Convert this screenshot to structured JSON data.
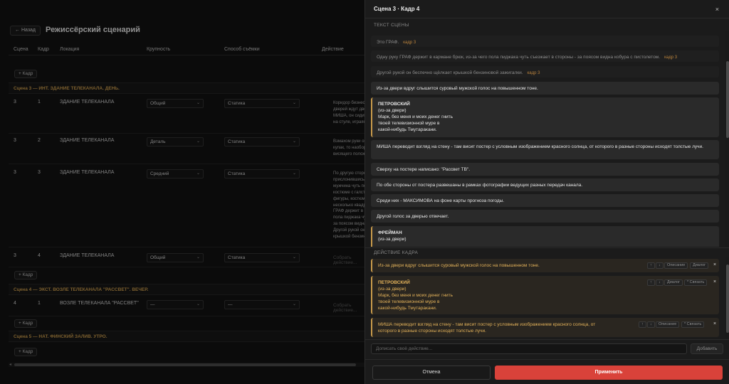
{
  "page": {
    "back_label": "← Назад",
    "title": "Режиссёрский сценарий",
    "columns": [
      "Сцена",
      "Кадр",
      "Локация",
      "Крупность",
      "Способ съёмки",
      "Действие"
    ],
    "add_frame_label": "+ Кадр",
    "action_placeholder": "Собрать действие...",
    "scenes": [
      {
        "header": "Сцена 3 — ИНТ. ЗДАНИЕ ТЕЛЕКАНАЛА. ДЕНЬ."
      },
      {
        "header": "Сцена 4 — ЭКСТ. ВОЗЛЕ ТЕЛЕКАНАЛА \"РАССВЕТ\". ВЕЧЕР."
      },
      {
        "header": "Сцена 5 — НАТ. ФИНСКИЙ ЗАЛИВ. УТРО."
      }
    ],
    "frames": [
      {
        "scene": "3",
        "frame": "1",
        "location": "ЗДАНИЕ ТЕЛЕКАНАЛА",
        "size": "Общий",
        "method": "Статика",
        "action": "Коридор бизнес-ц\nдверей ждут двое\nМИША, он сидит,\nна стуле, играясь\n"
      },
      {
        "scene": "3",
        "frame": "2",
        "location": "ЗДАНИЕ ТЕЛЕКАНАЛА",
        "size": "Деталь",
        "method": "Статика",
        "action": "Взмахом руки он\nкулак, то наоборо\nвисящего положе"
      },
      {
        "scene": "3",
        "frame": "3",
        "location": "ЗДАНИЕ ТЕЛЕКАНАЛА",
        "size": "Средний",
        "method": "Статика",
        "action": "По другую сторон\nприслонившись к\nмужчина чуть пос\nкостюме с галсту\nфигуры, костюм с\nнесколько квадра\nГРАФ держит в ка\nпола пиджака чут\nза поясом видна к\nДругой рукой он б\nкрышкой бензинов"
      },
      {
        "scene": "3",
        "frame": "4",
        "location": "ЗДАНИЕ ТЕЛЕКАНАЛА",
        "size": "Общий",
        "method": "Статика",
        "action": ""
      },
      {
        "scene": "4",
        "frame": "1",
        "location": "ВОЗЛЕ ТЕЛЕКАНАЛА \"РАССВЕТ\"",
        "size": "—",
        "method": "—",
        "action": ""
      }
    ]
  },
  "modal": {
    "title": "Сцена 3 · Кадр 4",
    "close_label": "×",
    "scene_text_label": "ТЕКСТ СЦЕНЫ",
    "scene_text": [
      {
        "text": "Это ГРАФ.",
        "tag": "кадр 3",
        "state": "used"
      },
      {
        "text": "Одну руку ГРАФ держит в кармане брюк, из-за чего пола пиджака чуть съезжает в стороны - за поясом видна кобура с пистолетом.",
        "tag": "кадр 3",
        "state": "used"
      },
      {
        "text": "Другой рукой он беспечно щёлкает крышкой бензиновой зажигалки.",
        "tag": "кадр 3",
        "state": "used"
      },
      {
        "text": "Из-за двери вдруг слышится суровый мужской голос на повышенном тоне.",
        "state": "free"
      },
      {
        "speaker": "ПЕТРОВСКИЙ",
        "paren": "(из-за двери)",
        "lines": [
          "Марк, без меня и моих денег гнить",
          "твоей телевизионной муре в",
          "какой-нибудь Тмутаракани."
        ],
        "state": "dialogue"
      },
      {
        "text": "МИША переводит взгляд на стену - там висит постер с условным изображением красного солнца, от которого в разные стороны исходят толстые лучи.",
        "state": "free"
      },
      {
        "text": "Сверху на постере написано: \"Рассвет ТВ\".",
        "state": "free"
      },
      {
        "text": "По обе стороны от постера развешаны в рамках фотографии ведущих разных передач канала.",
        "state": "free"
      },
      {
        "text": "Среди них - МАКСИМОВА на фоне карты прогноза погоды.",
        "state": "free"
      },
      {
        "text": "Другой голос за дверью отвечает.",
        "state": "free"
      },
      {
        "speaker": "ФРЕЙМАН",
        "paren": "(из-за двери)",
        "lines": [],
        "state": "dialogue"
      }
    ],
    "action_label": "ДЕЙСТВИЕ КАДРА",
    "actions": [
      {
        "text": "Из-за двери вдруг слышится суровый мужской голос на повышенном тоне.",
        "controls": [
          "↑",
          "↓",
          "Описание",
          "Диалог"
        ]
      },
      {
        "speaker": "ПЕТРОВСКИЙ",
        "paren": "(из-за двери)",
        "lines": [
          "Марк, без меня и моих денег гнить",
          "твоей телевизионной муре в",
          "какой-нибудь Тмутаракани."
        ],
        "controls": [
          "↑",
          "↓",
          "Диалог",
          "* Связать"
        ]
      },
      {
        "text": "МИША переводит взгляд на стену - там висит постер с условным изображением красного солнца, от\nкоторого в разные стороны исходят толстые лучи.",
        "controls": [
          "↑",
          "↓",
          "Описание",
          "* Связать"
        ]
      }
    ],
    "custom_placeholder": "Дописать своё действие...",
    "add_label": "Добавить",
    "cancel_label": "Отмена",
    "apply_label": "Применить"
  },
  "colors": {
    "accent": "#c89a4b",
    "apply": "#d9423a",
    "action_text": "#e3b25a"
  }
}
